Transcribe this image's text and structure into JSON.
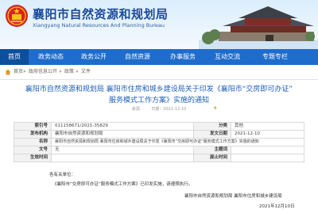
{
  "header": {
    "site_title": "襄阳市自然资源和规划局",
    "site_subtitle": "Xiangyang Natural Resources And Planning Bureau"
  },
  "nav": {
    "items": [
      {
        "label": "首页"
      },
      {
        "label": "政务动态"
      },
      {
        "label": "政务公开"
      },
      {
        "label": "自然资源"
      },
      {
        "label": "办事服务"
      },
      {
        "label": "互动交流"
      },
      {
        "label": "专题专栏"
      }
    ],
    "active_index": 0
  },
  "breadcrumb": {
    "items": [
      "首页",
      "政府信息公开",
      "政策",
      "文件"
    ],
    "separator": "»"
  },
  "article": {
    "title_line1": "襄阳市自然资源和规划局 襄阳市住房和城乡建设局关于印发《襄阳市“交房即可办证”",
    "title_line2": "服务模式工作方案》实施的通知",
    "meta_left": "来源：",
    "meta_date": "日期：2021-12-10"
  },
  "info_table": {
    "rows": [
      {
        "label1": "索引号",
        "value1": "011158671/2021-35829",
        "label2": "分类",
        "value2": "其他"
      },
      {
        "label1": "发布机构",
        "value1": "襄阳市自然资源和规划局",
        "label2": "发文日期",
        "value2": "2021-12-10"
      },
      {
        "label1": "名称",
        "value1": "襄阳市自然资源和规划局 襄阳市住房和城乡建设局关于印发《襄阳市“交房即可办证”服务模式工作方案》实施的通知"
      },
      {
        "label1": "文号",
        "value1": "无",
        "label2": "主题词",
        "value2": ""
      },
      {
        "label1": "生效时间",
        "value1": "",
        "label2": "废止时间",
        "value2": ""
      }
    ]
  },
  "body": {
    "salutation": "各有关单位：",
    "paragraph": "《襄阳市“交房即可办证”服务模式工作方案》已印发实施，请遵照执行。",
    "signature": "襄阳市自然资源和规划局  襄阳市住房和城乡建设局",
    "date": "2021年12月10日"
  },
  "colors": {
    "nav_bg": "#1e6ccb",
    "title_blue": "#1c5fb8",
    "header_blue": "#1b4a9b"
  }
}
